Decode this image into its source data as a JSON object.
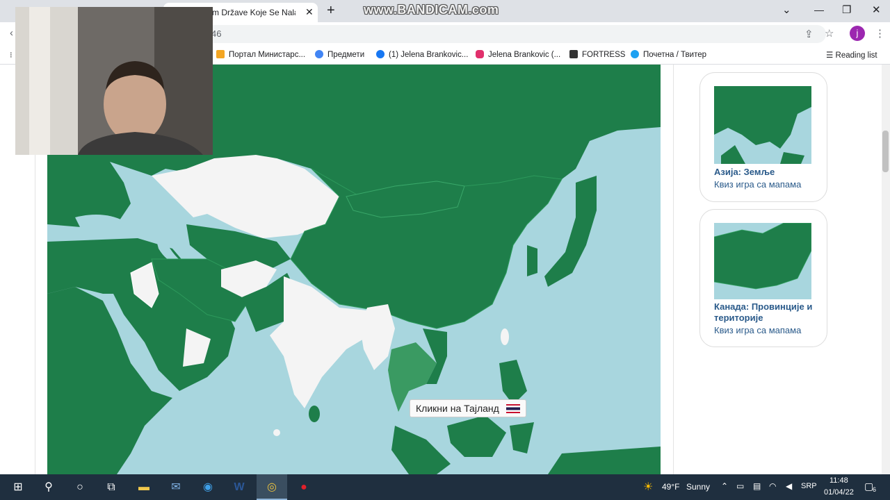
{
  "browser": {
    "tab_title": "m Države Koje Se Nalaze",
    "new_tab": "+",
    "url_fragment": "46",
    "profile_initial": "j",
    "watermark": "www.BANDICAM.com",
    "window_controls": {
      "minimize": "⌄",
      "restore": "❐",
      "close": "✕"
    }
  },
  "bookmarks": [
    {
      "label": "Портал Министарс...",
      "color": "#f4a623"
    },
    {
      "label": "Предмети",
      "color": "#4285f4"
    },
    {
      "label": "(1) Jelena Brankovic...",
      "color": "#1877f2"
    },
    {
      "label": "Jelena Brankovic (...",
      "color": "#e1306c"
    },
    {
      "label": "FORTRESS",
      "color": "#333333"
    },
    {
      "label": "Почетна / Твитер",
      "color": "#1da1f2"
    }
  ],
  "reading_list": "Reading list",
  "map": {
    "prompt": "Кликни на Тајланд",
    "colors": {
      "sea": "#a8d6de",
      "land": "#1e7e4a",
      "unanswered": "#f4f4f4",
      "highlight": "#3a9a62"
    }
  },
  "cards": [
    {
      "title": "Азија: Земље",
      "subtitle": "Квиз игра са мапама"
    },
    {
      "title": "Канада: Провинције и територије",
      "subtitle": "Квиз игра са мапама"
    }
  ],
  "taskbar": {
    "weather_temp": "49°F",
    "weather_text": "Sunny",
    "language": "SRP",
    "time": "11:48",
    "date": "01/04/22",
    "notifications": "6"
  }
}
